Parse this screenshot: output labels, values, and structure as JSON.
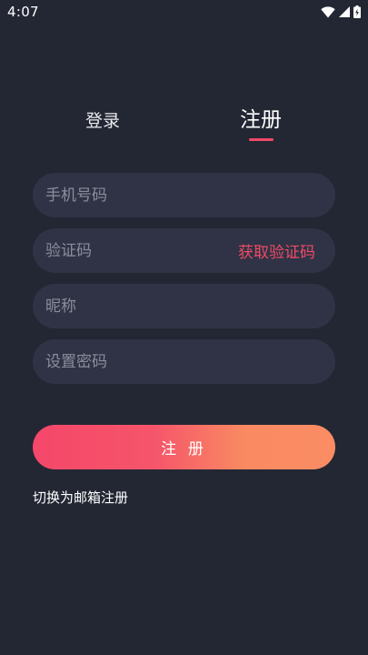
{
  "status_bar": {
    "time": "4:07",
    "icons": [
      "wifi-icon",
      "signal-icon",
      "battery-icon"
    ]
  },
  "tabs": [
    {
      "label": "登录",
      "active": false
    },
    {
      "label": "注册",
      "active": true
    }
  ],
  "form": {
    "phone": {
      "placeholder": "手机号码",
      "value": ""
    },
    "code": {
      "placeholder": "验证码",
      "value": "",
      "action_label": "获取验证码"
    },
    "nickname": {
      "placeholder": "昵称",
      "value": ""
    },
    "password": {
      "placeholder": "设置密码",
      "value": ""
    }
  },
  "submit_label": "注 册",
  "switch_label": "切换为邮箱注册",
  "colors": {
    "background": "#232734",
    "field_background": "#2f3345",
    "accent": "#f04a66",
    "gradient_start": "#f5476a",
    "gradient_end": "#fb8c63"
  }
}
